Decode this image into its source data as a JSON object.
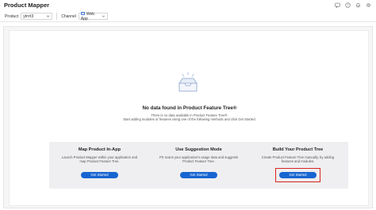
{
  "app": {
    "title": "Product Mapper"
  },
  "top_icons": [
    "chat-icon",
    "help-icon",
    "notification-icon",
    "settings-icon"
  ],
  "filters": {
    "product_label": "Product",
    "product_value": "ytrrrt3",
    "channel_label": "Channel",
    "channel_value": "Web App"
  },
  "empty_state": {
    "title": "No data found in Product Feature Tree®",
    "line1": "There is no data available in Product Feature Tree®.",
    "line2": "Start adding modules or features using one of the following methods and click Get Started."
  },
  "cards": [
    {
      "title": "Map Product In-App",
      "desc": "Launch Product Mapper within your application and map Product Feature Tree.",
      "button": "Get Started"
    },
    {
      "title": "Use Suggestion Mode",
      "desc": "PX scans your application's usage data and suggests Product Feature Tree.",
      "button": "Get Started"
    },
    {
      "title": "Build Your Product Tree",
      "desc": "Create Product Feature Tree manually, by adding features and modules.",
      "button": "Get Started"
    }
  ],
  "colors": {
    "primary_button": "#1765d1",
    "highlight_box": "#d9231e",
    "card_background": "#efeff1"
  }
}
